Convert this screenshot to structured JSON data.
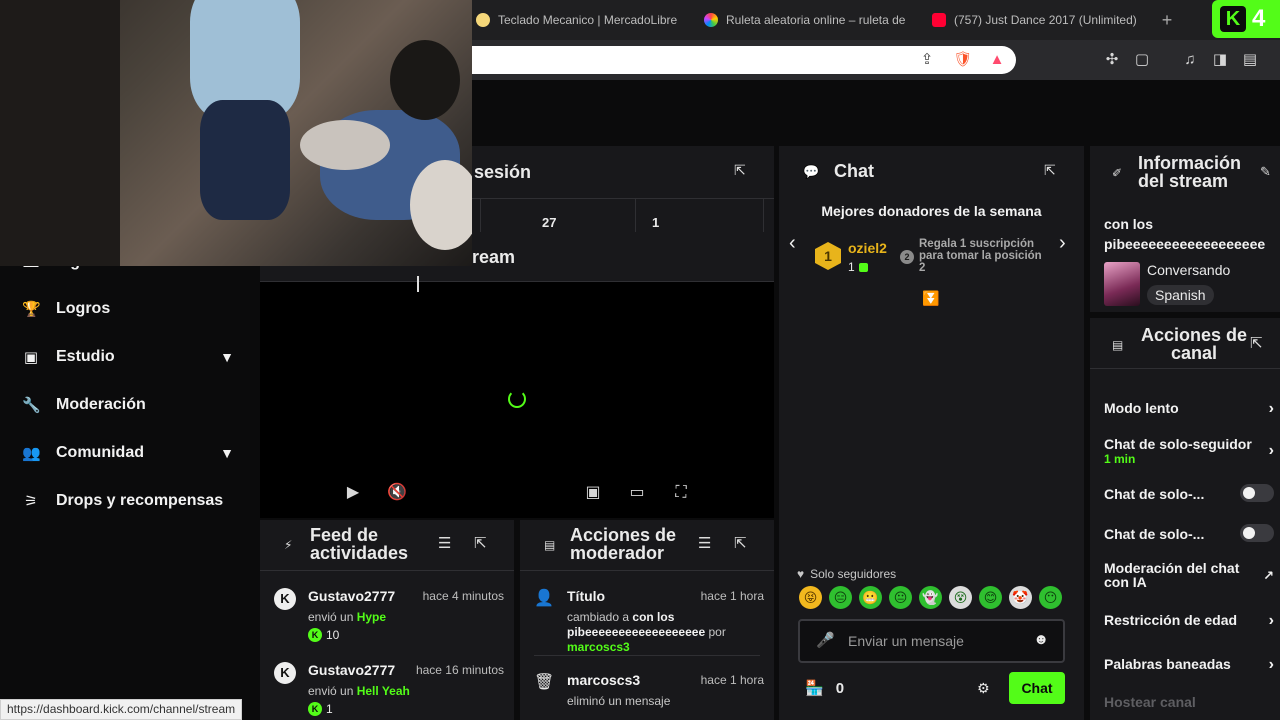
{
  "browser": {
    "tabs": [
      {
        "label": "Teclado Mecanico | MercadoLibre",
        "favicon_color": "#f5d77a"
      },
      {
        "label": "Ruleta aleatoria online – ruleta de",
        "favicon_color": "#e04fd0"
      },
      {
        "label": "(757) Just Dance 2017 (Unlimited)",
        "favicon_color": "#ff0033"
      }
    ],
    "new_tab": "+",
    "extension_badge": "4",
    "status_url": "https://dashboard.kick.com/channel/stream"
  },
  "sidebar": {
    "items": [
      {
        "label": "Ingresos",
        "icon": "money-icon",
        "glyph": "▬"
      },
      {
        "label": "Logros",
        "icon": "trophy-icon",
        "glyph": "🏆"
      },
      {
        "label": "Estudio",
        "icon": "studio-icon",
        "glyph": "▣",
        "expandable": true
      },
      {
        "label": "Moderación",
        "icon": "wrench-icon",
        "glyph": "🔧"
      },
      {
        "label": "Comunidad",
        "icon": "community-icon",
        "glyph": "👥",
        "expandable": true
      },
      {
        "label": "Drops y recompensas",
        "icon": "drops-icon",
        "glyph": "⚞"
      }
    ]
  },
  "session": {
    "title": "sesión",
    "cells": [
      "27",
      "1"
    ]
  },
  "stream_panel": {
    "title": "ream"
  },
  "feed": {
    "title": "Feed de actividades",
    "events": [
      {
        "user": "Gustavo2777",
        "time": "hace 4 minutos",
        "action": "envió un",
        "item": "Hype",
        "amount": "10"
      },
      {
        "user": "Gustavo2777",
        "time": "hace 16 minutos",
        "action": "envió un",
        "item": "Hell Yeah",
        "amount": "1"
      }
    ]
  },
  "mod_actions": {
    "title": "Acciones de moderador",
    "entries": [
      {
        "title": "Título",
        "time": "hace 1 hora",
        "prefix": "cambiado a",
        "value": "con los pibeeeeeeeeeeeeeeeeee",
        "by": "por",
        "user": "marcoscs3"
      },
      {
        "title": "marcoscs3",
        "time": "hace 1 hora",
        "desc": "eliminó un mensaje"
      }
    ]
  },
  "chat": {
    "title": "Chat",
    "donors_title": "Mejores donadores de la semana",
    "top_donor": {
      "rank": "1",
      "name": "oziel2",
      "count": "1"
    },
    "second_rank": "2",
    "second_text": "Regala 1 suscripción para tomar la posición 2",
    "mode_label": "Solo seguidores",
    "emotes": [
      "😝",
      "😑",
      "😬",
      "😐",
      "👻",
      "😵",
      "😊",
      "🤡",
      "😶"
    ],
    "input_placeholder": "Enviar un mensaje",
    "kicks_count": "0",
    "send_label": "Chat"
  },
  "stream_info": {
    "title": "Información del stream",
    "stream_title_line1": "con los",
    "stream_title_line2": "pibeeeeeeeeeeeeeeeeee",
    "category": "Conversando",
    "language": "Spanish"
  },
  "channel_actions": {
    "title": "Acciones de canal",
    "items": [
      {
        "label": "Modo lento",
        "control": "chevron"
      },
      {
        "label": "Chat de solo-seguidores",
        "sub": "1 min",
        "control": "chevron"
      },
      {
        "label": "Chat de solo-...",
        "control": "toggle"
      },
      {
        "label": "Chat de solo-...",
        "control": "toggle"
      },
      {
        "label": "Moderación del chat con IA",
        "control": "external"
      },
      {
        "label": "Restricción de edad",
        "control": "chevron"
      },
      {
        "label": "Palabras baneadas",
        "control": "chevron"
      }
    ],
    "host_label": "Hostear canal"
  },
  "colors": {
    "accent": "#53fc18",
    "panel": "#18181b",
    "background": "#0b0b0c",
    "gold": "#e8b41b"
  }
}
